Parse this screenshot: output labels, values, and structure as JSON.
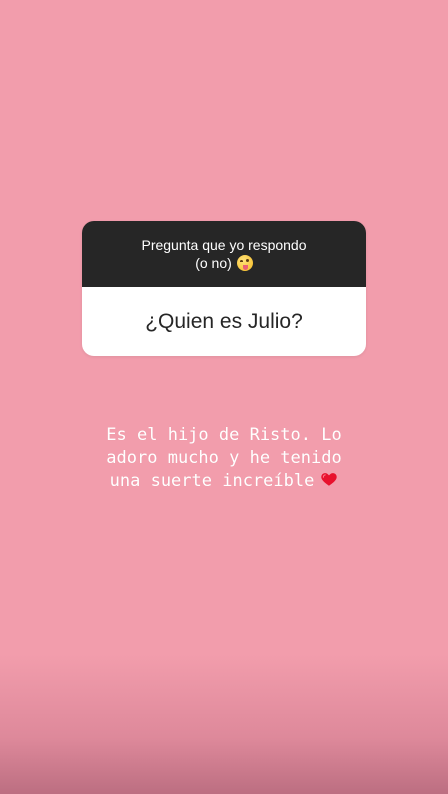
{
  "colors": {
    "background": "#f29dac",
    "card_header": "#262626",
    "card_body": "#ffffff",
    "answer_text": "#ffffff",
    "heart": "#e8112d"
  },
  "question_sticker": {
    "prompt_line1": "Pregunta que yo respondo",
    "prompt_line2": "(o no)",
    "emoji": "zany-face-emoji",
    "question": "¿Quien es Julio?"
  },
  "answer": {
    "line1": "Es el hijo de Risto. Lo",
    "line2": "adoro mucho y he tenido",
    "line3": "una suerte increíble",
    "emoji": "red-heart-emoji"
  }
}
